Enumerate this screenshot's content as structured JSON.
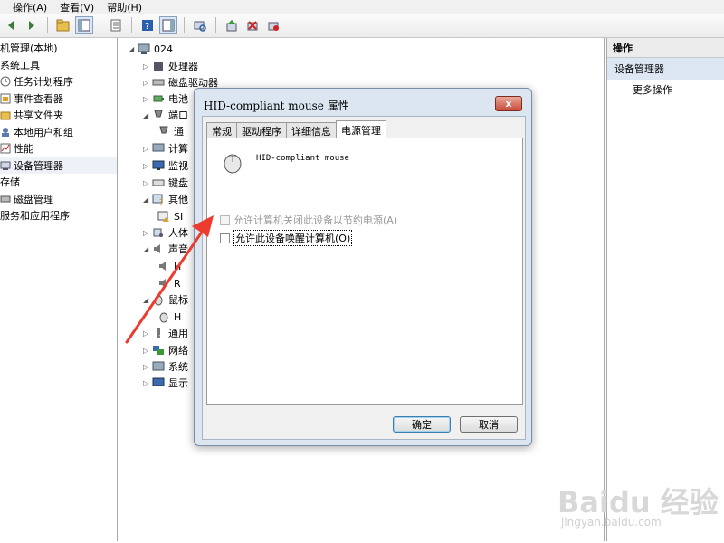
{
  "menu": [
    "操作(A)",
    "查看(V)",
    "帮助(H)"
  ],
  "toolbar": {
    "buttons": [
      "back-icon",
      "forward-icon",
      "folder-icon",
      "console-tree-icon",
      "properties-icon",
      "help-icon",
      "action-pane-icon",
      "scan-icon",
      "update-driver-icon",
      "uninstall-icon",
      "disable-icon"
    ]
  },
  "left_tree": [
    "机管理(本地)",
    "系统工具",
    "任务计划程序",
    "事件查看器",
    "共享文件夹",
    "本地用户和组",
    "性能",
    "设备管理器",
    "存储",
    "磁盘管理",
    "服务和应用程序"
  ],
  "device_tree": {
    "root": "024",
    "items": [
      "处理器",
      "磁盘驱动器",
      "电池",
      "端口",
      "通",
      "计算",
      "监视",
      "键盘",
      "其他",
      "SI",
      "人体",
      "声音",
      "H",
      "R",
      "鼠标",
      "H",
      "通用",
      "网络",
      "系统",
      "显示"
    ]
  },
  "right_pane": {
    "header": "操作",
    "selected": "设备管理器",
    "more": "更多操作"
  },
  "dialog": {
    "title": "HID-compliant mouse 属性",
    "close_label": "x",
    "tabs": [
      "常规",
      "驱动程序",
      "详细信息",
      "电源管理"
    ],
    "active_tab": "电源管理",
    "device_name": "HID-compliant mouse",
    "option_allow_power_off": "允许计算机关闭此设备以节约电源(A)",
    "option_allow_wake": "允许此设备唤醒计算机(O)",
    "ok_label": "确定",
    "cancel_label": "取消"
  },
  "watermark": {
    "main": "Baidu 经验",
    "sub": "jingyan.baidu.com"
  },
  "colors": {
    "arrow": "#ee3b2f",
    "dialog_frame": "#dbe6f1",
    "selection": "#dde6f3"
  }
}
